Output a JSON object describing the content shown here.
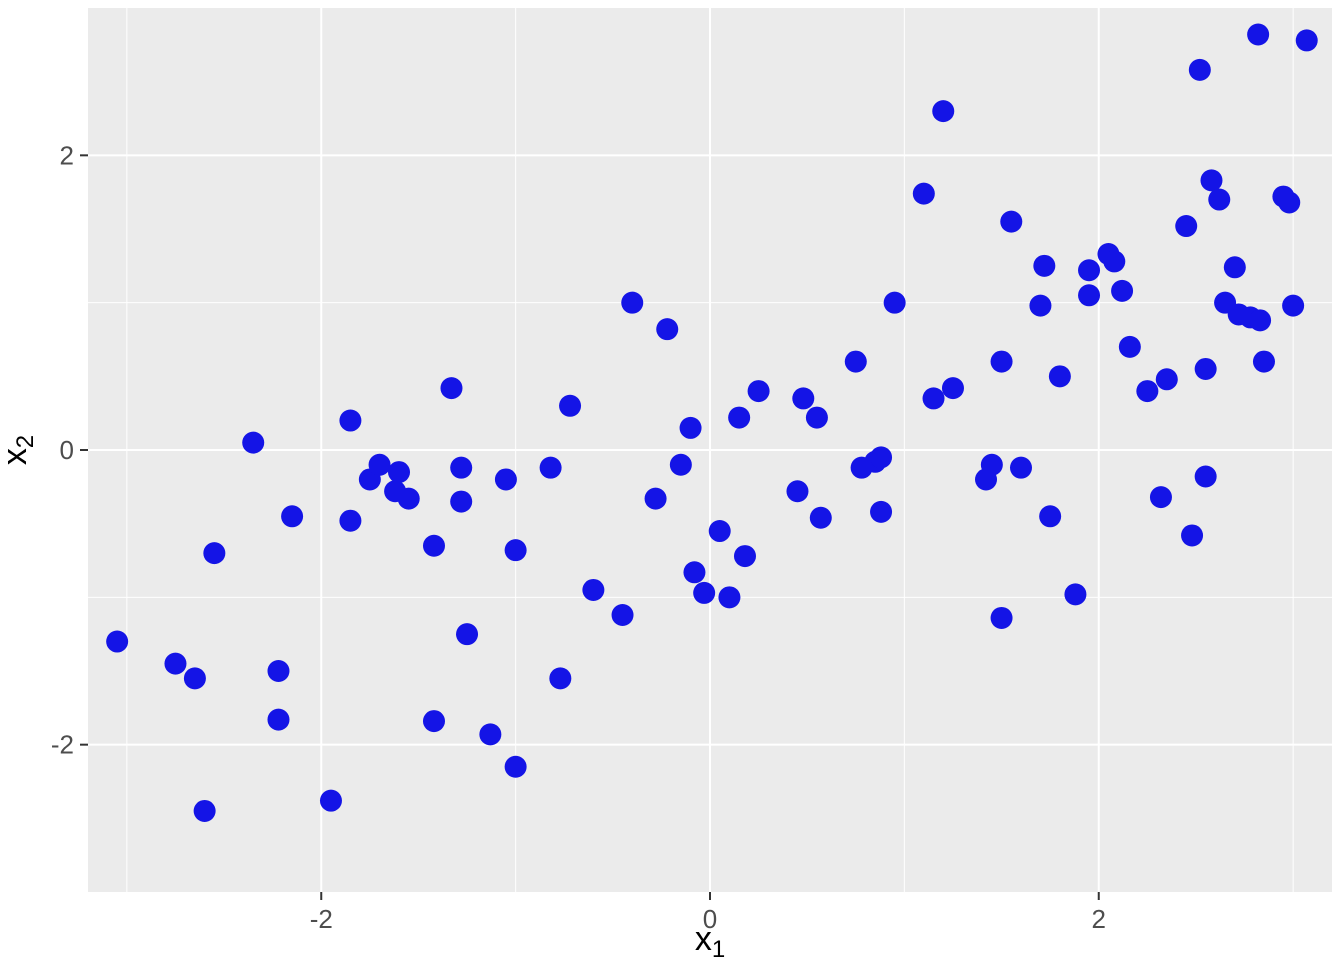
{
  "chart_data": {
    "type": "scatter",
    "xlabel": "x",
    "xlabel_sub": "1",
    "ylabel": "x",
    "ylabel_sub": "2",
    "xlim": [
      -3.2,
      3.2
    ],
    "ylim": [
      -3.0,
      3.0
    ],
    "x_ticks": [
      -2,
      0,
      2
    ],
    "y_ticks": [
      -2,
      0,
      2
    ],
    "x_tick_labels": [
      "-2",
      "0",
      "2"
    ],
    "y_tick_labels": [
      "-2",
      "0",
      "2"
    ],
    "point_color": "#1414e6",
    "point_radius": 11,
    "series": [
      {
        "name": "points",
        "points": [
          [
            -3.05,
            -1.3
          ],
          [
            -2.75,
            -1.45
          ],
          [
            -2.65,
            -1.55
          ],
          [
            -2.6,
            -2.45
          ],
          [
            -2.55,
            -0.7
          ],
          [
            -2.35,
            0.05
          ],
          [
            -2.22,
            -1.5
          ],
          [
            -2.22,
            -1.83
          ],
          [
            -2.15,
            -0.45
          ],
          [
            -1.95,
            -2.38
          ],
          [
            -1.85,
            -0.48
          ],
          [
            -1.85,
            0.2
          ],
          [
            -1.75,
            -0.2
          ],
          [
            -1.7,
            -0.1
          ],
          [
            -1.62,
            -0.28
          ],
          [
            -1.6,
            -0.15
          ],
          [
            -1.55,
            -0.33
          ],
          [
            -1.42,
            -0.65
          ],
          [
            -1.42,
            -1.84
          ],
          [
            -1.33,
            0.42
          ],
          [
            -1.28,
            -0.12
          ],
          [
            -1.28,
            -0.35
          ],
          [
            -1.25,
            -1.25
          ],
          [
            -1.13,
            -1.93
          ],
          [
            -1.05,
            -0.2
          ],
          [
            -1.0,
            -0.68
          ],
          [
            -1.0,
            -2.15
          ],
          [
            -0.82,
            -0.12
          ],
          [
            -0.77,
            -1.55
          ],
          [
            -0.72,
            0.3
          ],
          [
            -0.6,
            -0.95
          ],
          [
            -0.45,
            -1.12
          ],
          [
            -0.4,
            1.0
          ],
          [
            -0.28,
            -0.33
          ],
          [
            -0.22,
            0.82
          ],
          [
            -0.15,
            -0.1
          ],
          [
            -0.1,
            0.15
          ],
          [
            -0.08,
            -0.83
          ],
          [
            -0.03,
            -0.97
          ],
          [
            0.05,
            -0.55
          ],
          [
            0.1,
            -1.0
          ],
          [
            0.15,
            0.22
          ],
          [
            0.18,
            -0.72
          ],
          [
            0.25,
            0.4
          ],
          [
            0.45,
            -0.28
          ],
          [
            0.48,
            0.35
          ],
          [
            0.55,
            0.22
          ],
          [
            0.57,
            -0.46
          ],
          [
            0.75,
            0.6
          ],
          [
            0.78,
            -0.12
          ],
          [
            0.85,
            -0.08
          ],
          [
            0.88,
            -0.05
          ],
          [
            0.88,
            -0.42
          ],
          [
            0.95,
            1.0
          ],
          [
            1.1,
            1.74
          ],
          [
            1.15,
            0.35
          ],
          [
            1.2,
            2.3
          ],
          [
            1.25,
            0.42
          ],
          [
            1.42,
            -0.2
          ],
          [
            1.45,
            -0.1
          ],
          [
            1.5,
            0.6
          ],
          [
            1.5,
            -1.14
          ],
          [
            1.55,
            1.55
          ],
          [
            1.6,
            -0.12
          ],
          [
            1.7,
            0.98
          ],
          [
            1.72,
            1.25
          ],
          [
            1.75,
            -0.45
          ],
          [
            1.8,
            0.5
          ],
          [
            1.88,
            -0.98
          ],
          [
            1.95,
            1.05
          ],
          [
            1.95,
            1.22
          ],
          [
            2.05,
            1.33
          ],
          [
            2.08,
            1.28
          ],
          [
            2.12,
            1.08
          ],
          [
            2.16,
            0.7
          ],
          [
            2.25,
            0.4
          ],
          [
            2.32,
            -0.32
          ],
          [
            2.35,
            0.48
          ],
          [
            2.45,
            1.52
          ],
          [
            2.48,
            -0.58
          ],
          [
            2.52,
            2.58
          ],
          [
            2.55,
            0.55
          ],
          [
            2.55,
            -0.18
          ],
          [
            2.58,
            1.83
          ],
          [
            2.62,
            1.7
          ],
          [
            2.65,
            1.0
          ],
          [
            2.7,
            1.24
          ],
          [
            2.72,
            0.92
          ],
          [
            2.78,
            0.9
          ],
          [
            2.83,
            0.88
          ],
          [
            2.82,
            2.82
          ],
          [
            2.85,
            0.6
          ],
          [
            2.95,
            1.72
          ],
          [
            2.98,
            1.68
          ],
          [
            3.0,
            0.98
          ],
          [
            3.07,
            2.78
          ]
        ]
      }
    ]
  }
}
